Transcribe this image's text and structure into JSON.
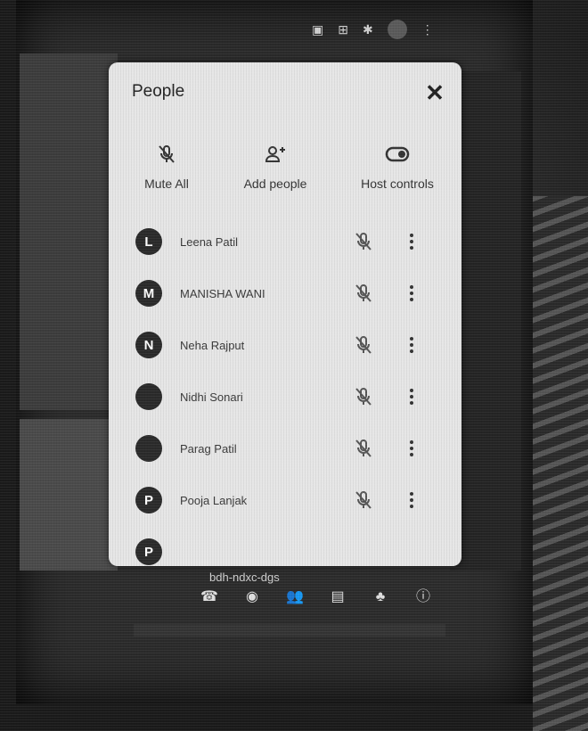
{
  "panel": {
    "title": "People",
    "close_label": "✕"
  },
  "actions": {
    "mute_all": "Mute All",
    "add_people": "Add people",
    "host_controls": "Host controls"
  },
  "participants": [
    {
      "initial": "L",
      "name": "Leena Patil"
    },
    {
      "initial": "M",
      "name": "MANISHA WANI"
    },
    {
      "initial": "N",
      "name": "Neha Rajput"
    },
    {
      "initial": "",
      "name": "Nidhi Sonari"
    },
    {
      "initial": "",
      "name": "Parag Patil"
    },
    {
      "initial": "P",
      "name": "Pooja Lanjak"
    },
    {
      "initial": "P",
      "name": ""
    }
  ],
  "meeting_bar": {
    "meeting_code": "bdh-ndxc-dgs"
  },
  "colors": {
    "panel_bg": "#e6e6e6",
    "avatar_bg": "#2a2a2a",
    "screen_bg": "#2b2b2b"
  }
}
